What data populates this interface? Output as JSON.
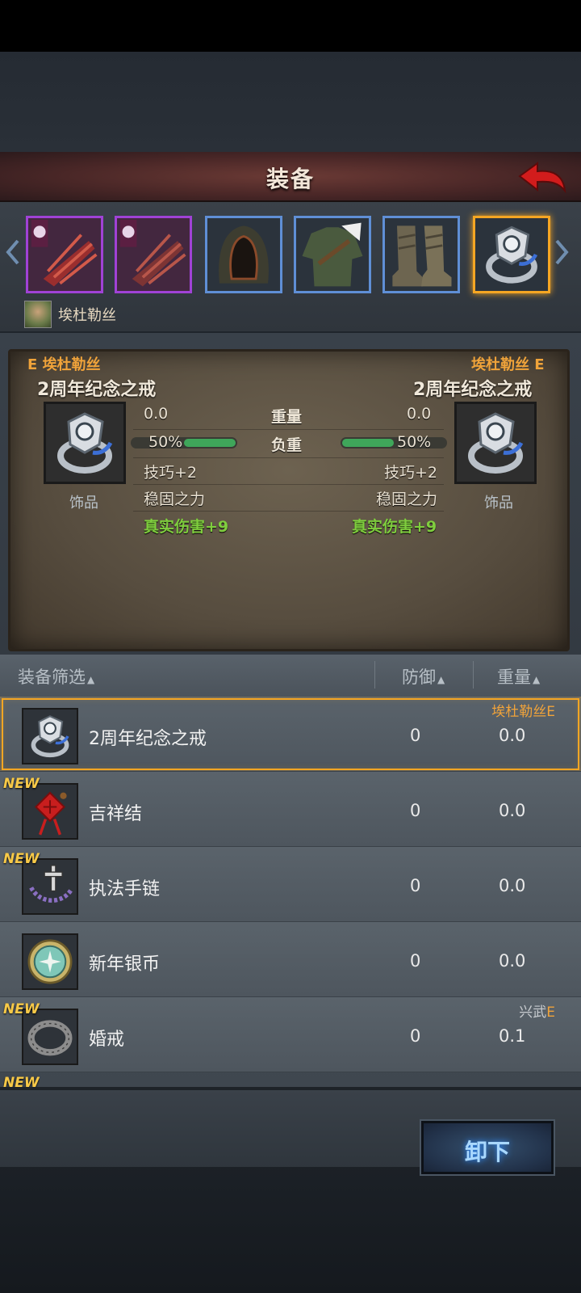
{
  "header": {
    "title": "装备"
  },
  "character": {
    "name": "埃杜勒丝"
  },
  "compare": {
    "left_tag": "E 埃杜勒丝",
    "right_tag": "埃杜勒丝 E",
    "left_name": "2周年纪念之戒",
    "right_name": "2周年纪念之戒",
    "left_type": "饰品",
    "right_type": "饰品",
    "weight_label": "重量",
    "load_label": "负重",
    "left_weight": "0.0",
    "right_weight": "0.0",
    "left_load": "50%",
    "right_load": "50%",
    "left_load_value": 0.5,
    "right_load_value": 0.5,
    "left_skill": "技巧+2",
    "right_skill": "技巧+2",
    "left_trait": "稳固之力",
    "right_trait": "稳固之力",
    "left_true_dmg": "真实伤害+9",
    "right_true_dmg": "真实伤害+9"
  },
  "filter": {
    "title": "装备筛选",
    "defense": "防御",
    "weight": "重量",
    "sort_icon": "triangle-up-icon"
  },
  "items": [
    {
      "name": "2周年纪念之戒",
      "defense": "0",
      "weight": "0.0",
      "owner": "埃杜勒丝",
      "owner_suffix": "E"
    },
    {
      "name": "吉祥结",
      "defense": "0",
      "weight": "0.0",
      "new": "NEW"
    },
    {
      "name": "执法手链",
      "defense": "0",
      "weight": "0.0",
      "new": "NEW"
    },
    {
      "name": "新年银币",
      "defense": "0",
      "weight": "0.0"
    },
    {
      "name": "婚戒",
      "defense": "0",
      "weight": "0.1",
      "new": "NEW",
      "owner": "兴武",
      "owner_suffix": "E"
    }
  ],
  "partial_new": "NEW",
  "footer": {
    "unequip": "卸下"
  },
  "colors": {
    "accent": "#f5a623",
    "green": "#7fce3e",
    "epic": "#a042d6",
    "rare": "#5f8fd6"
  }
}
